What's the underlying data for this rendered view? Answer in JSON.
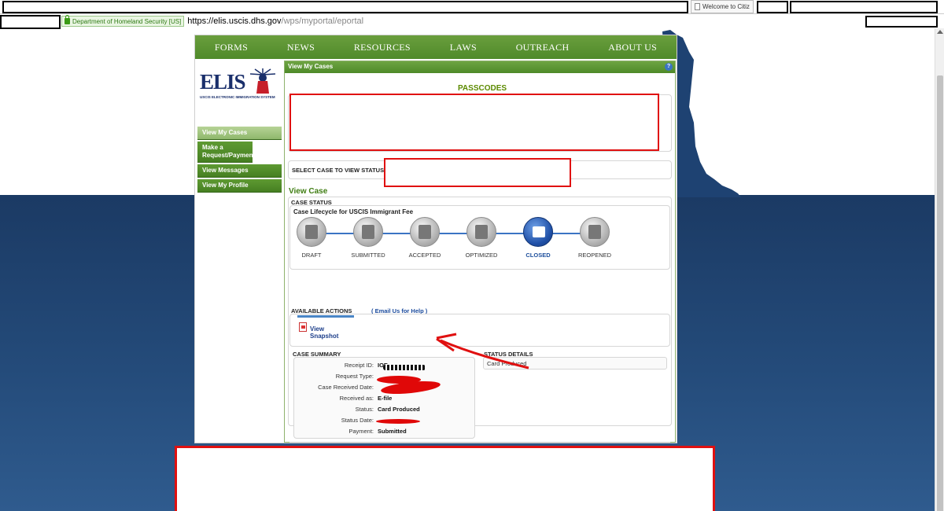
{
  "browser": {
    "tab_title": "Welcome to Citiz",
    "secure_label": "Department of Homeland Security [US]",
    "url_host": "https://elis.uscis.dhs.gov",
    "url_path": "/wps/myportal/eportal"
  },
  "top_nav": [
    "FORMS",
    "NEWS",
    "RESOURCES",
    "LAWS",
    "OUTREACH",
    "ABOUT US"
  ],
  "logo": {
    "text": "ELIS",
    "subtitle": "USCIS ELECTRONIC IMMIGRATION SYSTEM"
  },
  "side_menu": [
    {
      "label": "View My Cases",
      "active": true
    },
    {
      "label": "Make a Request/Payment",
      "active": false
    },
    {
      "label": "View Messages",
      "active": false
    },
    {
      "label": "View My Profile",
      "active": false
    }
  ],
  "panel": {
    "header": "View My Cases",
    "help": "?",
    "passcodes_title": "PASSCODES",
    "select_case_label": "SELECT CASE TO VIEW STATUS",
    "view_case_title": "View Case",
    "case_status_label": "CASE STATUS",
    "lifecycle_title": "Case Lifecycle for USCIS Immigrant Fee",
    "lifecycle_steps": [
      {
        "name": "DRAFT",
        "icon": "draft-icon"
      },
      {
        "name": "SUBMITTED",
        "icon": "submitted-icon"
      },
      {
        "name": "ACCEPTED",
        "icon": "accepted-icon"
      },
      {
        "name": "OPTIMIZED",
        "icon": "optimized-icon"
      },
      {
        "name": "CLOSED",
        "icon": "closed-icon",
        "current": true
      },
      {
        "name": "REOPENED",
        "icon": "reopened-icon"
      }
    ],
    "available_actions_label": "AVAILABLE ACTIONS",
    "email_link": "( Email Us for Help )",
    "snapshot_label": "View Snapshot",
    "case_summary_label": "CASE SUMMARY",
    "status_details_label": "STATUS DETAILS",
    "status_details_value": "Card Produced",
    "summary": [
      {
        "key": "Receipt ID:",
        "value": "IOE"
      },
      {
        "key": "Request Type:",
        "value": ""
      },
      {
        "key": "Case Received Date:",
        "value": ""
      },
      {
        "key": "Received as:",
        "value": "E-file"
      },
      {
        "key": "Status:",
        "value": "Card Produced"
      },
      {
        "key": "Status Date:",
        "value": ""
      },
      {
        "key": "Payment:",
        "value": "Submitted"
      }
    ]
  },
  "colors": {
    "nav_green": "#4f8a2a",
    "title_green": "#5c8a00",
    "closed_blue": "#1f4fa6",
    "redaction_red": "#e01010",
    "page_blue": "#1b3a64"
  }
}
